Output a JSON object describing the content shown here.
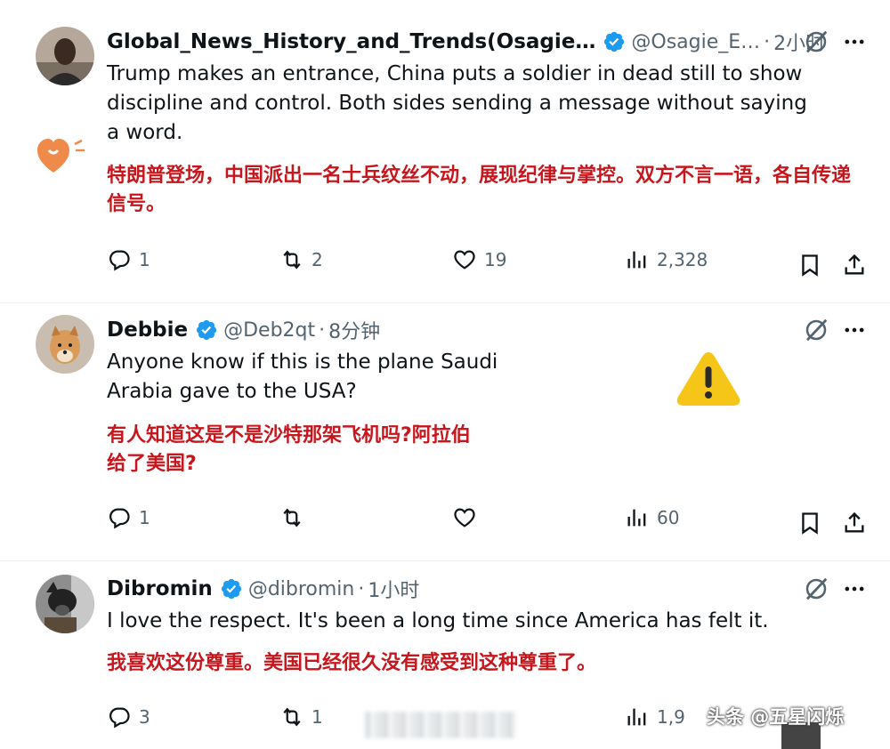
{
  "tweets": [
    {
      "name": "Global_News_History_and_Trends(Osagie…",
      "handle": "@Osagie_E…",
      "time": "2小时",
      "text_en": "Trump makes an entrance, China puts a soldier in dead still to show discipline and control. Both sides sending a message without saying a word.",
      "text_zh": "特朗普登场，中国派出一名士兵纹丝不动，展现纪律与掌控。双方不言一语，各自传递信号。",
      "replies": "1",
      "reposts": "2",
      "likes": "19",
      "views": "2,328"
    },
    {
      "name": "Debbie",
      "handle": "@Deb2qt",
      "time": "8分钟",
      "text_en": "Anyone know if this is the plane Saudi Arabia gave to the USA?",
      "text_zh": "有人知道这是不是沙特那架飞机吗?阿拉伯给了美国?",
      "replies": "1",
      "reposts": "",
      "likes": "",
      "views": "60"
    },
    {
      "name": "Dibromin",
      "handle": "@dibromin",
      "time": "1小时",
      "text_en": "I love the respect.  It's been a long time since America has felt it.",
      "text_zh": "我喜欢这份尊重。美国已经很久没有感受到这种尊重了。",
      "replies": "3",
      "reposts": "1",
      "likes": "",
      "views": "1,9"
    }
  ],
  "watermark": "头条 @五星闪烁",
  "icons": {
    "verified": "verified-badge-icon",
    "grok": "grok-icon",
    "more": "more-icon",
    "reply": "reply-icon",
    "repost": "repost-icon",
    "like": "like-icon",
    "views": "views-icon",
    "bookmark": "bookmark-icon",
    "share": "share-icon",
    "warning": "warning-icon",
    "heart_badge": "heart-badge-icon"
  },
  "colors": {
    "verified": "#1d9bf0",
    "translation": "#c8161d",
    "secondary": "#536471",
    "warning": "#f5c518"
  }
}
